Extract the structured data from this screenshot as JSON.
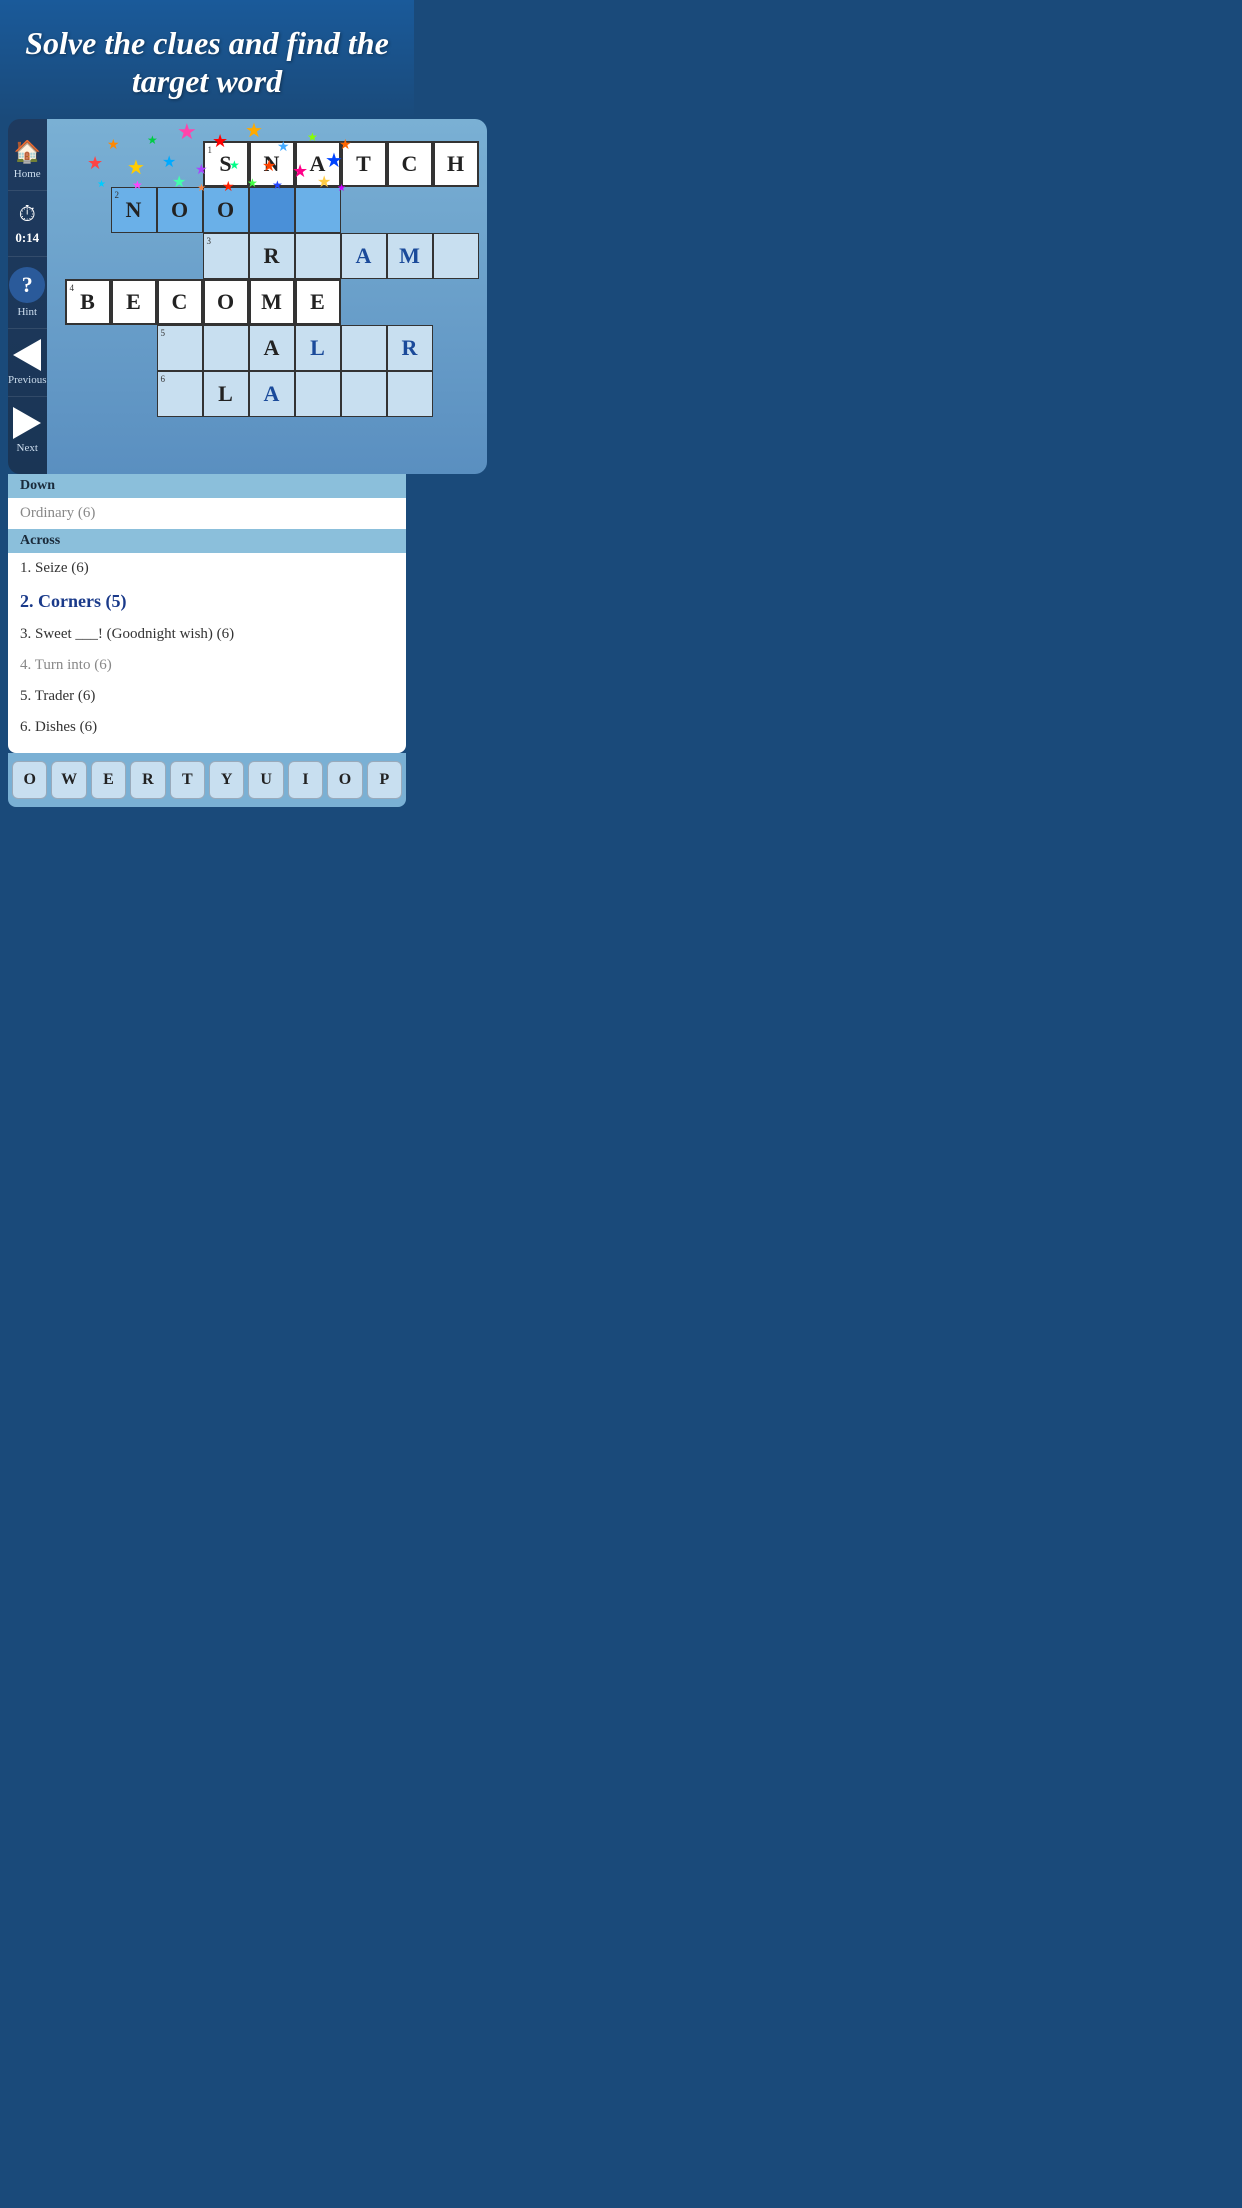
{
  "header": {
    "title": "Solve the clues and find the target word"
  },
  "sidebar": {
    "home_label": "Home",
    "timer_label": "0:14",
    "hint_label": "Hint",
    "prev_label": "Previous",
    "next_label": "Next"
  },
  "clues": {
    "down_header": "Down",
    "down_items": [
      {
        "text": "Ordinary (6)",
        "active": false,
        "dark": false
      }
    ],
    "across_header": "Across",
    "across_items": [
      {
        "num": "1.",
        "text": "Seize (6)",
        "active": false,
        "dark": true
      },
      {
        "num": "2.",
        "text": "Corners (5)",
        "active": true,
        "dark": false
      },
      {
        "num": "3.",
        "text": "Sweet ___! (Goodnight wish) (6)",
        "active": false,
        "dark": true
      },
      {
        "num": "4.",
        "text": "Turn into (6)",
        "active": false,
        "dark": false
      },
      {
        "num": "5.",
        "text": "Trader (6)",
        "active": false,
        "dark": true
      },
      {
        "num": "6.",
        "text": "Dishes (6)",
        "active": false,
        "dark": true
      }
    ]
  },
  "keyboard_keys": [
    "O",
    "W",
    "E",
    "R",
    "T",
    "Y",
    "U",
    "I",
    "O",
    "P"
  ]
}
